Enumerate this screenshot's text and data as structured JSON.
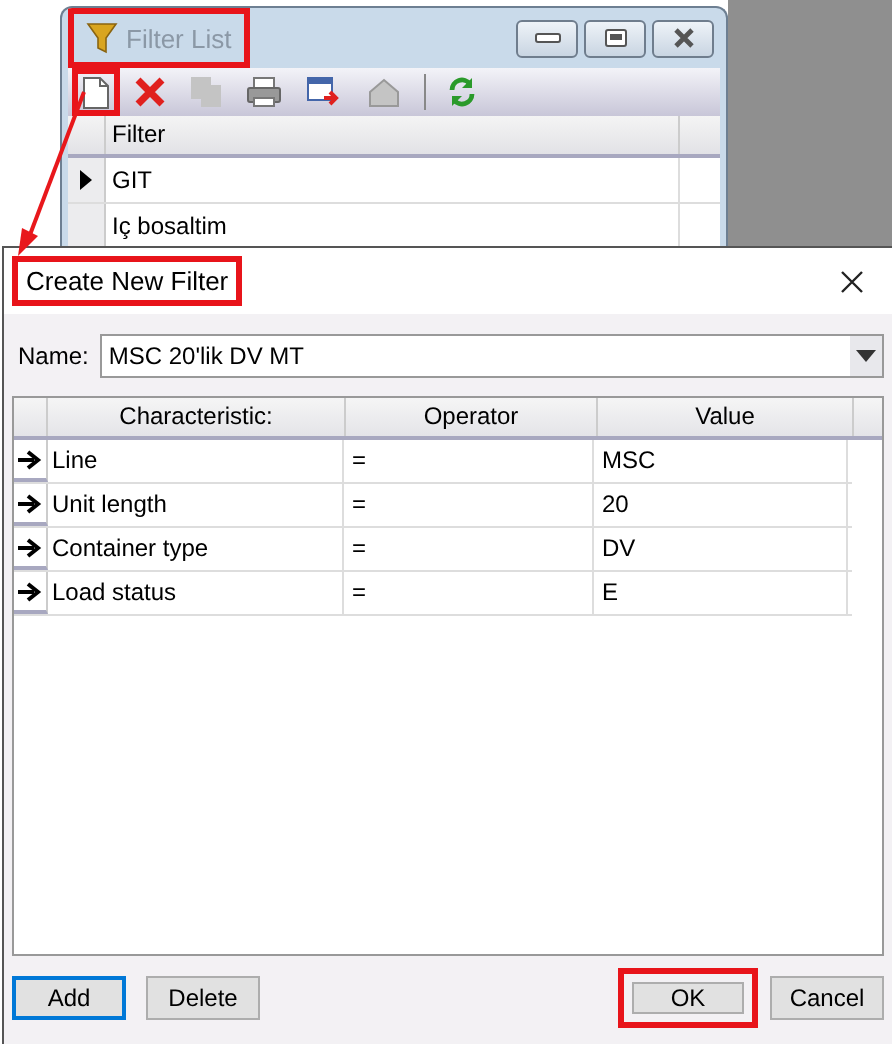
{
  "filter_list": {
    "title": "Filter List",
    "title_highlighted": true,
    "toolbar_groups": [
      {
        "buttons": [
          {
            "kind": "new",
            "disabled": false,
            "highlighted": true
          },
          {
            "kind": "delete",
            "disabled": false,
            "highlighted": false
          },
          {
            "kind": "copy",
            "disabled": true,
            "highlighted": false
          },
          {
            "kind": "print",
            "disabled": false,
            "highlighted": false
          },
          {
            "kind": "export",
            "disabled": false,
            "highlighted": false
          },
          {
            "kind": "properties",
            "disabled": true,
            "highlighted": false
          }
        ]
      },
      {
        "buttons": [
          {
            "kind": "refresh",
            "disabled": false,
            "highlighted": false
          }
        ]
      }
    ],
    "column": "Filter",
    "rows": [
      {
        "name": "GIT",
        "selected": true
      },
      {
        "name": "Iç bosaltim",
        "selected": false
      }
    ]
  },
  "dialog": {
    "title": "Create New Filter",
    "title_highlighted": true,
    "name_label": "Name:",
    "name_value": "MSC 20'lik DV MT",
    "columns": [
      "Characteristic:",
      "Operator",
      "Value"
    ],
    "rows": [
      {
        "characteristic": "Line",
        "operator": "=",
        "value": "MSC"
      },
      {
        "characteristic": "Unit length",
        "operator": "=",
        "value": "20"
      },
      {
        "characteristic": "Container type",
        "operator": "=",
        "value": "DV"
      },
      {
        "characteristic": "Load status",
        "operator": "=",
        "value": "E"
      }
    ],
    "buttons_left": [
      {
        "label": "Add",
        "focused": true,
        "highlighted": false
      },
      {
        "label": "Delete",
        "focused": false,
        "highlighted": false
      }
    ],
    "buttons_right": [
      {
        "label": "OK",
        "focused": false,
        "highlighted": true
      },
      {
        "label": "Cancel",
        "focused": false,
        "highlighted": false
      }
    ]
  }
}
